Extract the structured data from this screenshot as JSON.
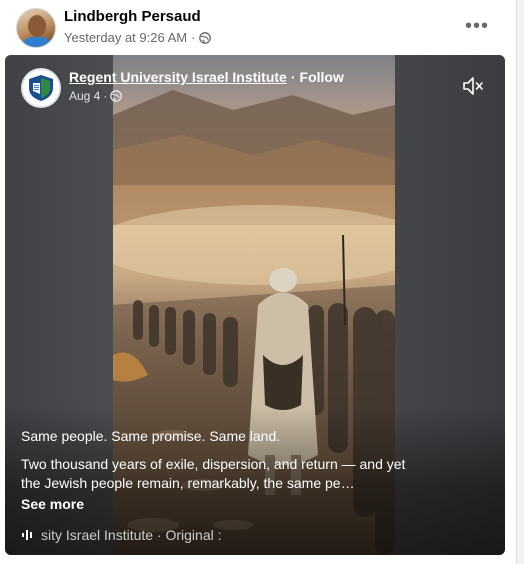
{
  "post": {
    "author_name": "Lindbergh Persaud",
    "timestamp": "Yesterday at 9:26 AM",
    "separator": "·",
    "more_icon_label": "•••",
    "audience_icon": "globe-icon"
  },
  "reel": {
    "page_name": "Regent University Israel Institute",
    "dot": "·",
    "follow_label": "Follow",
    "date": "Aug 4",
    "date_separator": "·",
    "mute_icon": "speaker-muted-icon",
    "caption_line1": "Same people. Same promise. Same land.",
    "caption_body": "Two thousand years of exile, dispersion, and return — and yet the Jewish people remain, remarkably, the same pe…",
    "see_more_label": "See more",
    "audio_text": "sity Israel Institute · Original :",
    "audio_icon": "audio-bars-icon",
    "logo_icon": "shield-logo-icon"
  },
  "colors": {
    "text_primary": "#050505",
    "text_secondary": "#65676b",
    "reel_bg": "#4b4d50",
    "logo_blue": "#1a4f8f",
    "logo_green": "#2e8b3e"
  }
}
